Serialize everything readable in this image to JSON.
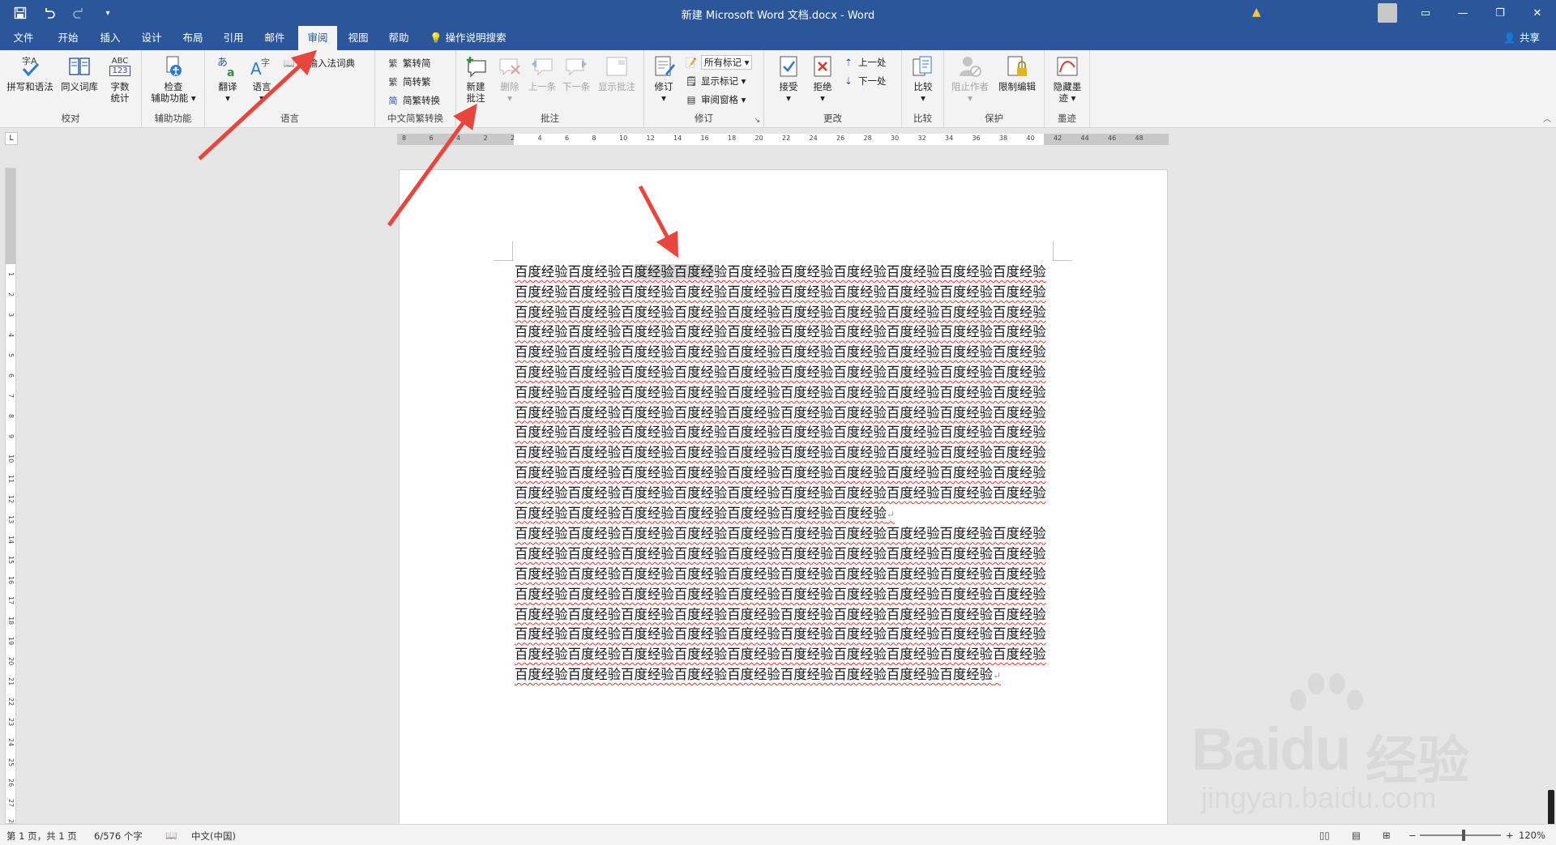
{
  "titlebar": {
    "title": "新建 Microsoft Word 文档.docx  -  Word",
    "qat": {
      "save_icon": "save-icon",
      "undo_icon": "undo-icon",
      "redo_icon": "redo-icon",
      "customize_icon": "customize-icon"
    },
    "accent": "#2b579a"
  },
  "tabs": [
    {
      "label": "文件"
    },
    {
      "label": "开始"
    },
    {
      "label": "插入"
    },
    {
      "label": "设计"
    },
    {
      "label": "布局"
    },
    {
      "label": "引用"
    },
    {
      "label": "邮件"
    },
    {
      "label": "审阅"
    },
    {
      "label": "视图"
    },
    {
      "label": "帮助"
    }
  ],
  "active_tab": "审阅",
  "tell_me": "操作说明搜索",
  "share": "共享",
  "ribbon": {
    "proofing": {
      "label": "校对",
      "spell": "拼写和语法",
      "thesaurus": "同义词库",
      "wordcount_line1": "字数",
      "wordcount_line2": "统计",
      "abc": "ABC",
      "num": "123"
    },
    "accessibility": {
      "label": "辅助功能",
      "check_line1": "检查",
      "check_line2": "辅助功能"
    },
    "language": {
      "label": "语言",
      "translate": "翻译",
      "language": "语言",
      "ime": "新输入法词典"
    },
    "chinese": {
      "label": "中文简繁转换",
      "t2s": "繁转简",
      "s2t": "简转繁",
      "convert": "简繁转换"
    },
    "comments": {
      "label": "批注",
      "new_line1": "新建",
      "new_line2": "批注",
      "delete": "删除",
      "prev": "上一条",
      "next": "下一条",
      "show": "显示批注"
    },
    "tracking": {
      "label": "修订",
      "track": "修订",
      "markup_select": "所有标记",
      "show_markup": "显示标记",
      "pane": "审阅窗格"
    },
    "changes": {
      "label": "更改",
      "accept": "接受",
      "reject": "拒绝",
      "prev": "上一处",
      "next": "下一处"
    },
    "compare": {
      "label": "比较",
      "compare": "比较"
    },
    "protect": {
      "label": "保护",
      "block": "阻止作者",
      "restrict": "限制编辑"
    },
    "ink": {
      "label": "墨迹",
      "hide_line1": "隐藏墨",
      "hide_line2": "迹"
    }
  },
  "ruler": {
    "h_numbers": [
      "8",
      "6",
      "4",
      "2",
      "2",
      "4",
      "6",
      "8",
      "10",
      "12",
      "14",
      "16",
      "18",
      "20",
      "22",
      "24",
      "26",
      "28",
      "30",
      "32",
      "34",
      "36",
      "38",
      "40",
      "42",
      "44",
      "46",
      "48"
    ],
    "v_numbers": [
      "1",
      "2",
      "3",
      "4",
      "5",
      "6",
      "7",
      "8",
      "9",
      "10",
      "11",
      "12",
      "13",
      "14",
      "15",
      "16",
      "17",
      "18",
      "19",
      "20",
      "21",
      "22",
      "23",
      "24",
      "25",
      "26",
      "27",
      "28"
    ],
    "corner_icon": "tab-stop-icon"
  },
  "document": {
    "para1_before": "百度经验百度经验百",
    "para1_selected": "度经验百度经",
    "para1_after": "验百度经验百度经验百度经验百度经验百度经验百度经验百度经验百度经验百度经验百度经验百度经验百度经验百度经验百度经验百度经验百度经验百度经验百度经验百度经验百度经验百度经验百度经验百度经验百度经验百度经验百度经验百度经验百度经验百度经验百度经验百度经验百度经验百度经验百度经验百度经验百度经验百度经验百度经验百度经验百度经验百度经验百度经验百度经验百度经验百度经验百度经验百度经验百度经验百度经验百度经验百度经验百度经验百度经验百度经验百度经验百度经验百度经验百度经验百度经验百度经验百度经验百度经验百度经验百度经验百度经验百度经验百度经验百度经验百度经验百度经验百度经验百度经验百度经验百度经验百度经验百度经验百度经验百度经验百度经验百度经验百度经验百度经验百度经验百度经验百度经验百度经验百度经验百度经验百度经验百度经验百度经验百度经验百度经验百度经验百度经验百度经验百度经验百度经验百度经验百度经验百度经验百度经验百度经验百度经验百度经验百度经验百度经验百度经验百度经验百度经验百度经验百度经验百度经验百度经验百度经验百度经验百度经验百度经验百度经验百度经验百度经验百度经验百度经验",
    "para2": "百度经验百度经验百度经验百度经验百度经验百度经验百度经验百度经验百度经验百度经验百度经验百度经验百度经验百度经验百度经验百度经验百度经验百度经验百度经验百度经验百度经验百度经验百度经验百度经验百度经验百度经验百度经验百度经验百度经验百度经验百度经验百度经验百度经验百度经验百度经验百度经验百度经验百度经验百度经验百度经验百度经验百度经验百度经验百度经验百度经验百度经验百度经验百度经验百度经验百度经验百度经验百度经验百度经验百度经验百度经验百度经验百度经验百度经验百度经验百度经验百度经验百度经验百度经验百度经验百度经验百度经验百度经验百度经验百度经验百度经验百度经验百度经验百度经验百度经验百度经验百度经验百度经验百度经验百度经验",
    "para_mark": "↵"
  },
  "statusbar": {
    "page": "第 1 页，共 1 页",
    "words": "6/576 个字",
    "language": "中文(中国)",
    "zoom": "120%",
    "zoom_out": "−",
    "zoom_in": "+"
  },
  "watermark": {
    "brand": "Baidu",
    "brand_cn": "经验",
    "url": "jingyan.baidu.com"
  },
  "colors": {
    "annotation_arrow": "#e8453c",
    "spell_underline": "#e0362c"
  }
}
